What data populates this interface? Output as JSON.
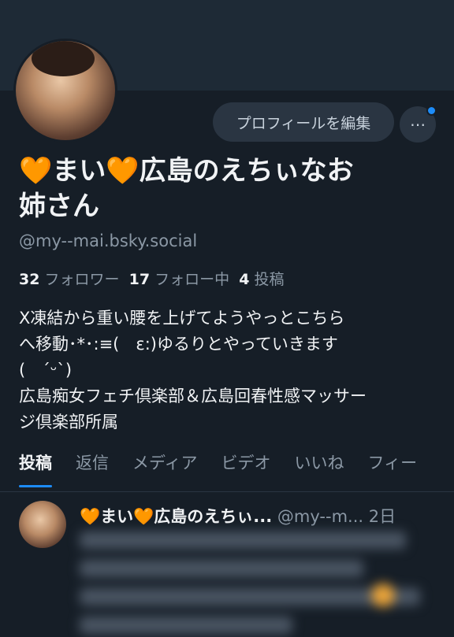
{
  "profile": {
    "edit_button": "プロフィールを編集",
    "more_label": "⋯",
    "display_name_line1": "🧡まい🧡広島のえちぃなお",
    "display_name_line2": "姉さん",
    "handle": "@my--mai.bsky.social",
    "followers_count": "32",
    "followers_label": "フォロワー",
    "following_count": "17",
    "following_label": "フォロー中",
    "posts_count": "4",
    "posts_label": "投稿",
    "bio": [
      "X凍結から重い腰を上げてようやっとこちら",
      "へ移動･*･:≡(　ε:)ゆるりとやっていきます",
      "(　ˊᵕˋ)",
      "広島痴女フェチ倶楽部＆広島回春性感マッサー",
      "ジ倶楽部所属"
    ]
  },
  "tabs": [
    "投稿",
    "返信",
    "メディア",
    "ビデオ",
    "いいね",
    "フィー"
  ],
  "active_tab": 0,
  "post": {
    "author": "🧡まい🧡広島のえちぃ...",
    "handle": "@my--m...",
    "time": "2日"
  },
  "colors": {
    "accent": "#1d8cf8",
    "background": "#161e27",
    "muted": "#8b98a5"
  }
}
